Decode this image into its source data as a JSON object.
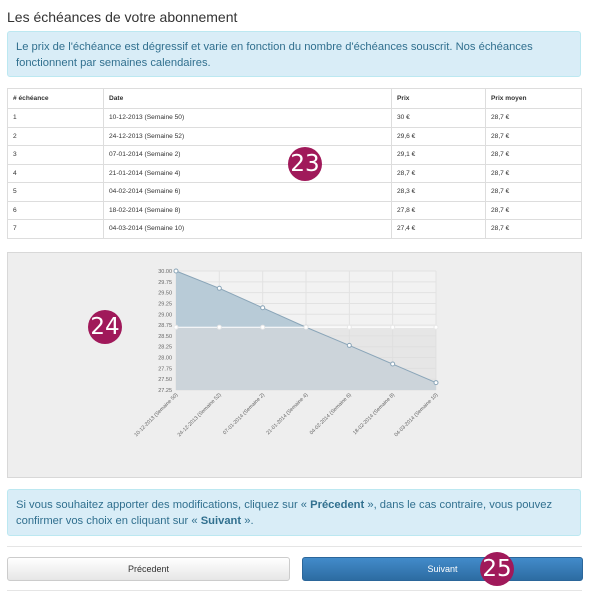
{
  "page": {
    "title": "Les échéances de votre abonnement",
    "intro": "Le prix de l'échéance est dégressif et varie en fonction du nombre d'échéances souscrit. Nos échéances fonctionnent par semaines calendaires."
  },
  "table": {
    "headers": [
      "# échéance",
      "Date",
      "Prix",
      "Prix moyen"
    ],
    "rows": [
      [
        "1",
        "10-12-2013 (Semaine 50)",
        "30 €",
        "28,7 €"
      ],
      [
        "2",
        "24-12-2013 (Semaine 52)",
        "29,6 €",
        "28,7 €"
      ],
      [
        "3",
        "07-01-2014 (Semaine 2)",
        "29,1 €",
        "28,7 €"
      ],
      [
        "4",
        "21-01-2014 (Semaine 4)",
        "28,7 €",
        "28,7 €"
      ],
      [
        "5",
        "04-02-2014 (Semaine 6)",
        "28,3 €",
        "28,7 €"
      ],
      [
        "6",
        "18-02-2014 (Semaine 8)",
        "27,8 €",
        "28,7 €"
      ],
      [
        "7",
        "04-03-2014 (Semaine 10)",
        "27,4 €",
        "28,7 €"
      ]
    ]
  },
  "chart_data": {
    "type": "area",
    "categories": [
      "10-12-2013 (Semaine 50)",
      "24-12-2013 (Semaine 52)",
      "07-01-2014 (Semaine 2)",
      "21-01-2014 (Semaine 4)",
      "04-02-2014 (Semaine 6)",
      "18-02-2014 (Semaine 8)",
      "04-03-2014 (Semaine 10)"
    ],
    "series": [
      {
        "values": [
          30.0,
          29.6,
          29.15,
          28.7,
          28.28,
          27.85,
          27.42
        ],
        "color": "#b8cbd7",
        "line_color": "#8aa5b8"
      },
      {
        "values": [
          28.7,
          28.7,
          28.7,
          28.7,
          28.7,
          28.7,
          28.7
        ],
        "color": "#dddddd",
        "line_color": "#ffffff"
      }
    ],
    "yticks": [
      "30.00",
      "29.75",
      "29.50",
      "29.25",
      "29.00",
      "28.75",
      "28.50",
      "28.25",
      "28.00",
      "27.75",
      "27.50",
      "27.25"
    ],
    "ylim": [
      27.25,
      30.0
    ],
    "grid": true
  },
  "bottom": {
    "pre": "Si vous souhaitez apporter des modifications, cliquez sur « ",
    "prev_word": "Précedent",
    "mid": " », dans le cas contraire, vous pouvez confirmer vos choix en cliquant sur « ",
    "next_word": "Suivant",
    "post": " »."
  },
  "buttons": {
    "prev": "Précedent",
    "next": "Suivant"
  },
  "markers": {
    "m23": "23",
    "m24": "24",
    "m25": "25"
  }
}
